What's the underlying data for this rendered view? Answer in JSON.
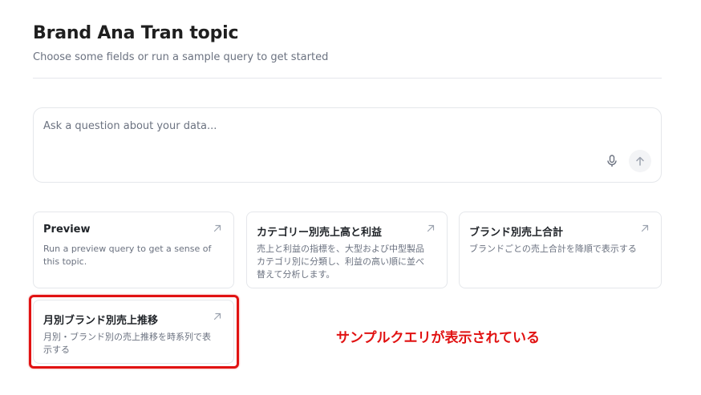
{
  "header": {
    "title": "Brand Ana Tran topic",
    "subtitle": "Choose some fields or run a sample query to get started"
  },
  "ask": {
    "placeholder": "Ask a question about your data..."
  },
  "icons": {
    "mic": "microphone-icon",
    "send": "arrow-up-icon",
    "card_open": "arrow-up-right-icon"
  },
  "cards": [
    {
      "title": "Preview",
      "description": "Run a preview query to get a sense of this topic."
    },
    {
      "title": "カテゴリー別売上高と利益",
      "description": "売上と利益の指標を、大型および中型製品カテゴリ別に分類し、利益の高い順に並べ替えて分析します。"
    },
    {
      "title": "ブランド別売上合計",
      "description": "ブランドごとの売上合計を降順で表示する"
    },
    {
      "title": "月別ブランド別売上推移",
      "description": "月別・ブランド別の売上推移を時系列で表示する"
    }
  ],
  "annotation": {
    "text": "サンプルクエリが表示されている",
    "color": "#e11212"
  }
}
